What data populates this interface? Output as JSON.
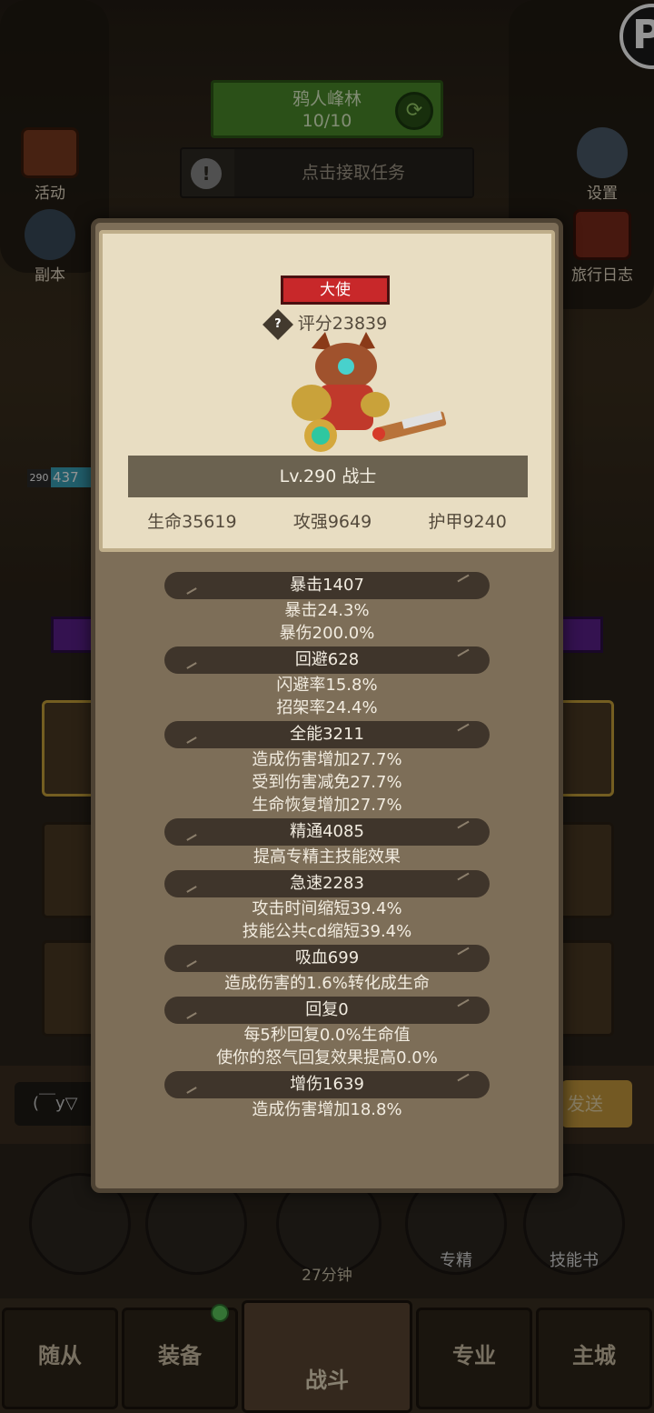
{
  "hud": {
    "zone_name": "鸦人峰林",
    "zone_progress": "10/10",
    "task_label": "点击接取任务",
    "left_menu": [
      {
        "label": "活动",
        "icon": "activity-board-icon"
      },
      {
        "label": "副本",
        "icon": "dungeon-portal-icon"
      }
    ],
    "right_menu": [
      {
        "label": "设置",
        "icon": "gear-icon"
      },
      {
        "label": "旅行日志",
        "icon": "travel-log-book-icon"
      }
    ],
    "hero_level_chip": "290",
    "hero_hp_chip": "437"
  },
  "chat": {
    "input_value": "(￣y▽",
    "send_label": "发送"
  },
  "action_buttons": [
    {
      "label": "",
      "icon": "potion-icon"
    },
    {
      "label": "",
      "icon": "bread-icon"
    },
    {
      "label": "27分钟",
      "icon": "treasure-chest-icon"
    },
    {
      "label": "专精",
      "icon": "specialization-icon"
    },
    {
      "label": "技能书",
      "icon": "skill-book-icon"
    }
  ],
  "bottom_nav": [
    {
      "label": "随从",
      "active": false
    },
    {
      "label": "装备",
      "active": false,
      "badge": true
    },
    {
      "label": "战斗",
      "active": true,
      "icon": "crossed-swords-icon"
    },
    {
      "label": "专业",
      "active": false
    },
    {
      "label": "主城",
      "active": false
    }
  ],
  "modal": {
    "title_badge": "大使",
    "score": "评分23839",
    "level_class": "Lv.290 战士",
    "base_stats": [
      {
        "label": "生命35619"
      },
      {
        "label": "攻强9649"
      },
      {
        "label": "护甲9240"
      }
    ],
    "stat_groups": [
      {
        "header": "暴击1407",
        "lines": [
          "暴击24.3%",
          "暴伤200.0%"
        ]
      },
      {
        "header": "回避628",
        "lines": [
          "闪避率15.8%",
          "招架率24.4%"
        ]
      },
      {
        "header": "全能3211",
        "lines": [
          "造成伤害增加27.7%",
          "受到伤害减免27.7%",
          "生命恢复增加27.7%"
        ]
      },
      {
        "header": "精通4085",
        "lines": [
          "提高专精主技能效果"
        ]
      },
      {
        "header": "急速2283",
        "lines": [
          "攻击时间缩短39.4%",
          "技能公共cd缩短39.4%"
        ]
      },
      {
        "header": "吸血699",
        "lines": [
          "造成伤害的1.6%转化成生命"
        ]
      },
      {
        "header": "回复0",
        "lines": [
          "每5秒回复0.0%生命值",
          "使你的怒气回复效果提高0.0%"
        ]
      },
      {
        "header": "增伤1639",
        "lines": [
          "造成伤害增加18.8%"
        ]
      }
    ]
  },
  "colors": {
    "modal_bg": "#7d6e58",
    "panel_bg": "#e8ddc2",
    "stat_header_bg": "#3f352b",
    "title_badge_bg": "#c8282a",
    "zone_box_bg": "#4a8a2a"
  }
}
